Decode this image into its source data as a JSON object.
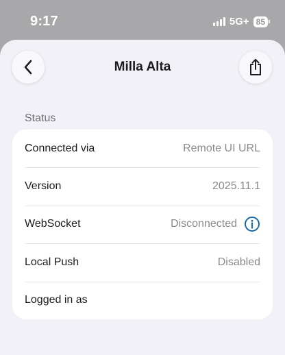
{
  "status_bar": {
    "time": "9:17",
    "network": "5G+",
    "battery": "85"
  },
  "nav": {
    "title": "Milla Alta",
    "back_icon": "chevron-left-icon",
    "share_icon": "share-icon"
  },
  "section": {
    "header": "Status"
  },
  "rows": [
    {
      "label": "Connected via",
      "value": "Remote UI URL"
    },
    {
      "label": "Version",
      "value": "2025.11.1"
    },
    {
      "label": "WebSocket",
      "value": "Disconnected"
    },
    {
      "label": "Local Push",
      "value": "Disabled"
    },
    {
      "label": "Logged in as",
      "value": ""
    }
  ],
  "colors": {
    "accent": "#1a6aa6",
    "background": "#f2f1f7",
    "card": "#ffffff"
  }
}
